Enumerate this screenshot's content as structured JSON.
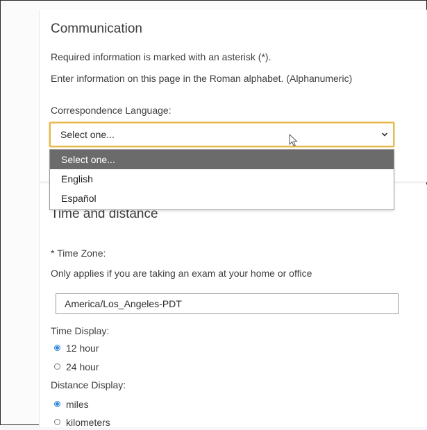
{
  "communication": {
    "title": "Communication",
    "required_note": "Required information is marked with an asterisk (*).",
    "alphabet_note": "Enter information on this page in the Roman alphabet. (Alphanumeric)",
    "language_label": "Correspondence Language:",
    "language_select": {
      "value": "Select one...",
      "options": [
        "Select one...",
        "English",
        "Español"
      ],
      "highlighted_index": 0
    }
  },
  "time_distance": {
    "title": "Time and distance",
    "time_zone_label": "* Time Zone:",
    "time_zone_note": "Only applies if you are taking an exam at your home or office",
    "time_zone_value": "America/Los_Angeles-PDT",
    "time_display_label": "Time Display:",
    "time_display_options": [
      {
        "label": "12 hour",
        "checked": true
      },
      {
        "label": "24 hour",
        "checked": false
      }
    ],
    "distance_display_label": "Distance Display:",
    "distance_display_options": [
      {
        "label": "miles",
        "checked": true
      },
      {
        "label": "kilometers",
        "checked": false
      }
    ]
  },
  "colors": {
    "focus_border": "#e7b84b",
    "selected_option_bg": "#6b6b6b",
    "radio_checked": "#2f86d8"
  },
  "icons": {
    "select_chevron": "chevron-down-icon",
    "mouse_cursor": "cursor-arrow-icon"
  }
}
